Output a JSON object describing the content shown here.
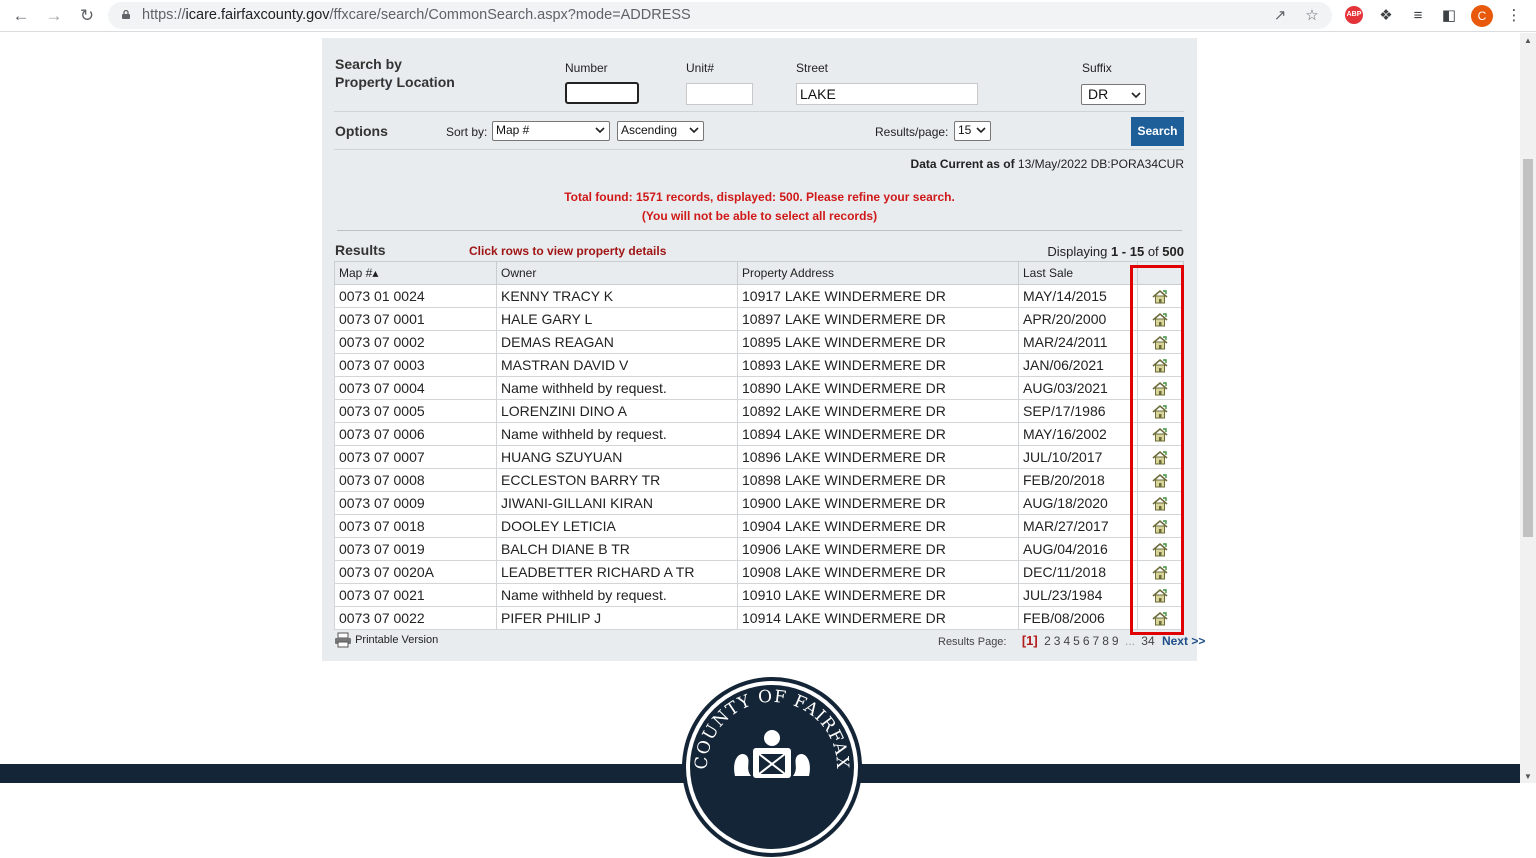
{
  "browser": {
    "url_prefix": "https://",
    "url_host": "icare.fairfaxcounty.gov",
    "url_path": "/ffxcare/search/CommonSearch.aspx?mode=ADDRESS",
    "abp_label": "ABP",
    "profile_initial": "C"
  },
  "search": {
    "heading": "Search by\nProperty Location",
    "number_label": "Number",
    "unit_label": "Unit#",
    "street_label": "Street",
    "suffix_label": "Suffix",
    "number_value": "",
    "unit_value": "",
    "street_value": "LAKE",
    "suffix_value": "DR"
  },
  "options": {
    "heading": "Options",
    "sort_by_label": "Sort by:",
    "sort_field": "Map #",
    "sort_order": "Ascending",
    "results_per_page_label": "Results/page:",
    "results_per_page": "15",
    "search_button": "Search"
  },
  "data_current": {
    "label": "Data Current as of",
    "value": "13/May/2022 DB:PORA34CUR"
  },
  "warning": {
    "line1": "Total found: 1571 records, displayed: 500. Please refine your search.",
    "line2": "(You will not be able to select all records)"
  },
  "results": {
    "heading": "Results",
    "hint": "Click rows to view property details",
    "displaying_label": "Displaying",
    "range": "1 - 15",
    "of_label": "of",
    "total": "500",
    "columns": [
      "Map #▴",
      "Owner",
      "Property Address",
      "Last Sale"
    ],
    "rows": [
      {
        "map": "0073 01 0024",
        "owner": "KENNY TRACY K",
        "address": "10917 LAKE WINDERMERE DR",
        "sale": "MAY/14/2015"
      },
      {
        "map": "0073 07 0001",
        "owner": "HALE GARY L",
        "address": "10897 LAKE WINDERMERE DR",
        "sale": "APR/20/2000"
      },
      {
        "map": "0073 07 0002",
        "owner": "DEMAS REAGAN",
        "address": "10895 LAKE WINDERMERE DR",
        "sale": "MAR/24/2011"
      },
      {
        "map": "0073 07 0003",
        "owner": "MASTRAN DAVID V",
        "address": "10893 LAKE WINDERMERE DR",
        "sale": "JAN/06/2021"
      },
      {
        "map": "0073 07 0004",
        "owner": "Name withheld by request.",
        "address": "10890 LAKE WINDERMERE DR",
        "sale": "AUG/03/2021"
      },
      {
        "map": "0073 07 0005",
        "owner": "LORENZINI DINO A",
        "address": "10892 LAKE WINDERMERE DR",
        "sale": "SEP/17/1986"
      },
      {
        "map": "0073 07 0006",
        "owner": "Name withheld by request.",
        "address": "10894 LAKE WINDERMERE DR",
        "sale": "MAY/16/2002"
      },
      {
        "map": "0073 07 0007",
        "owner": "HUANG SZUYUAN",
        "address": "10896 LAKE WINDERMERE DR",
        "sale": "JUL/10/2017"
      },
      {
        "map": "0073 07 0008",
        "owner": "ECCLESTON BARRY TR",
        "address": "10898 LAKE WINDERMERE DR",
        "sale": "FEB/20/2018"
      },
      {
        "map": "0073 07 0009",
        "owner": "JIWANI-GILLANI KIRAN",
        "address": "10900 LAKE WINDERMERE DR",
        "sale": "AUG/18/2020"
      },
      {
        "map": "0073 07 0018",
        "owner": "DOOLEY LETICIA",
        "address": "10904 LAKE WINDERMERE DR",
        "sale": "MAR/27/2017"
      },
      {
        "map": "0073 07 0019",
        "owner": "BALCH DIANE B TR",
        "address": "10906 LAKE WINDERMERE DR",
        "sale": "AUG/04/2016"
      },
      {
        "map": "0073 07 0020A",
        "owner": "LEADBETTER RICHARD A TR",
        "address": "10908 LAKE WINDERMERE DR",
        "sale": "DEC/11/2018"
      },
      {
        "map": "0073 07 0021",
        "owner": "Name withheld by request.",
        "address": "10910 LAKE WINDERMERE DR",
        "sale": "JUL/23/1984"
      },
      {
        "map": "0073 07 0022",
        "owner": "PIFER PHILIP J",
        "address": "10914 LAKE WINDERMERE DR",
        "sale": "FEB/08/2006"
      }
    ]
  },
  "footer_links": {
    "printable": "Printable Version",
    "results_page_label": "Results Page:",
    "current_page": "[1]",
    "pages": [
      "2",
      "3",
      "4",
      "5",
      "6",
      "7",
      "8",
      "9"
    ],
    "ellipsis": "...",
    "last_page": "34",
    "next": "Next >>"
  },
  "seal": {
    "text": "COUNTY OF FAIRFAX"
  },
  "colors": {
    "panel_bg": "#e8ecee",
    "search_button": "#1f5f99",
    "warning_text": "#d01818",
    "highlight_box": "#e00000",
    "footer_band": "#142537"
  }
}
